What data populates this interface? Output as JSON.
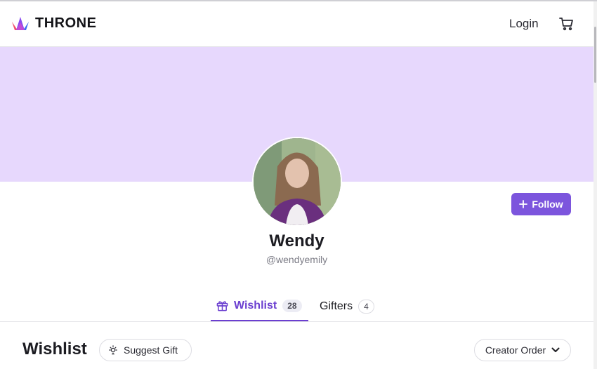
{
  "header": {
    "logo_text": "THRONE",
    "login_label": "Login",
    "cart_icon": "cart-icon"
  },
  "profile": {
    "name": "Wendy",
    "handle": "@wendyemily",
    "follow_label": "Follow"
  },
  "tabs": [
    {
      "label": "Wishlist",
      "count": "28",
      "active": true,
      "icon": "gift-icon"
    },
    {
      "label": "Gifters",
      "count": "4",
      "active": false
    }
  ],
  "wishlist": {
    "title": "Wishlist",
    "suggest_label": "Suggest Gift",
    "order_label": "Creator Order"
  },
  "colors": {
    "accent": "#7c55dd",
    "banner": "#e7d8fd"
  }
}
